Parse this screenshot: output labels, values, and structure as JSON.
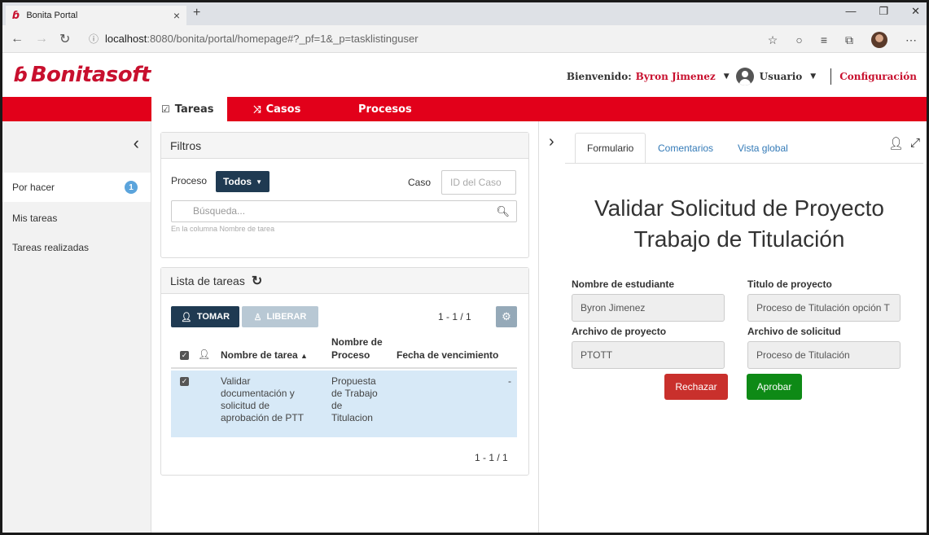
{
  "browser": {
    "tab_title": "Bonita Portal",
    "tab_close": "×",
    "new_tab": "+",
    "url_host": "localhost",
    "url_rest": ":8080/bonita/portal/homepage#?_pf=1&_p=tasklistinguser"
  },
  "header": {
    "logo_text": "Bonitasoft",
    "welcome_label": "Bienvenido:",
    "user_name": "Byron Jimenez",
    "user_menu": "Usuario",
    "config": "Configuración"
  },
  "nav": {
    "tabs": [
      {
        "label": "Tareas",
        "icon": "checkbox-icon"
      },
      {
        "label": "Casos",
        "icon": "shuffle-icon"
      },
      {
        "label": "Procesos"
      }
    ]
  },
  "sidebar": {
    "items": [
      {
        "label": "Por hacer",
        "badge": "1"
      },
      {
        "label": "Mis tareas"
      },
      {
        "label": "Tareas realizadas"
      }
    ]
  },
  "filters": {
    "title": "Filtros",
    "process_label": "Proceso",
    "process_value": "Todos",
    "case_label": "Caso",
    "case_placeholder": "ID del Caso",
    "search_placeholder": "Búsqueda...",
    "search_hint": "En la columna Nombre de tarea"
  },
  "tasklist": {
    "title": "Lista de tareas",
    "take_label": "TOMAR",
    "release_label": "LIBERAR",
    "pager": "1 - 1 / 1",
    "columns": {
      "task_name": "Nombre de tarea",
      "process_name_1": "Nombre de",
      "process_name_2": "Proceso",
      "due_date": "Fecha de vencimiento"
    },
    "rows": [
      {
        "task_lines": [
          "Validar",
          "documentación y",
          "solicitud de",
          "aprobación de PTT"
        ],
        "process_lines": [
          "Propuesta",
          "de Trabajo",
          "de",
          "Titulacion"
        ],
        "due": "-"
      }
    ],
    "pager_bottom": "1 - 1 / 1"
  },
  "form": {
    "tabs": [
      "Formulario",
      "Comentarios",
      "Vista global"
    ],
    "title_line1": "Validar Solicitud de Proyecto",
    "title_line2": "Trabajo de Titulación",
    "student_label": "Nombre de estudiante",
    "student_value": "Byron Jimenez",
    "project_title_label": "Titulo de proyecto",
    "project_title_value": "Proceso de Titulación opción T",
    "project_file_label": "Archivo de proyecto",
    "project_file_value": "PTOTT",
    "request_file_label": "Archivo de solicitud",
    "request_file_value": "Proceso de Titulación",
    "reject_label": "Rechazar",
    "approve_label": "Aprobar"
  },
  "colors": {
    "brand_red": "#e2001a",
    "dark_navy": "#1f3a52",
    "row_highlight": "#d7e9f7",
    "approve_green": "#0e8a16",
    "reject_red": "#c9302c"
  }
}
